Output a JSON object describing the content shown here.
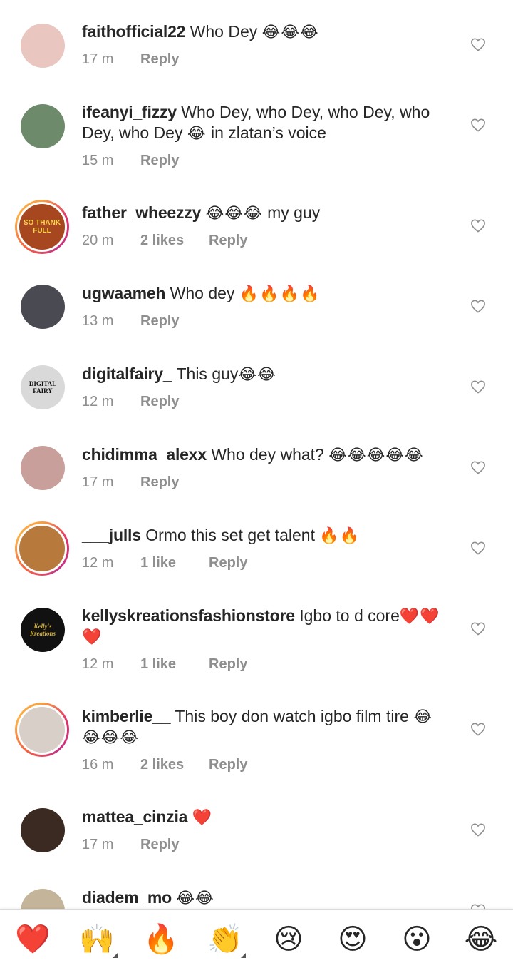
{
  "comments": [
    {
      "username": "faithofficial22",
      "text": "Who Dey ",
      "emoji": "😂😂😂",
      "text2": "",
      "emoji2": "",
      "time": "17 m",
      "likes": "",
      "reply": "Reply",
      "avatar_color": "#e9c7c0",
      "avatar_label": "",
      "story": false
    },
    {
      "username": "ifeanyi_fizzy",
      "text": "Who Dey, who Dey, who Dey, who Dey, who Dey ",
      "emoji": "😂",
      "text2": " in zlatan’s voice",
      "emoji2": "",
      "time": "15 m",
      "likes": "",
      "reply": "Reply",
      "avatar_color": "#6d8a6a",
      "avatar_label": "",
      "story": false
    },
    {
      "username": "father_wheezzy",
      "text": "",
      "emoji": "😂😂😂",
      "text2": " my guy",
      "emoji2": "",
      "time": "20 m",
      "likes": "2 likes",
      "reply": "Reply",
      "avatar_color": "#a6471f",
      "avatar_label": "SO THANK FULL",
      "story": true
    },
    {
      "username": "ugwaameh",
      "text": "Who dey ",
      "emoji": "🔥🔥🔥🔥",
      "text2": "",
      "emoji2": "",
      "time": "13 m",
      "likes": "",
      "reply": "Reply",
      "avatar_color": "#4a4a52",
      "avatar_label": "",
      "story": false
    },
    {
      "username": "digitalfairy_",
      "text": "This guy",
      "emoji": "😂😂",
      "text2": "",
      "emoji2": "",
      "time": "12 m",
      "likes": "",
      "reply": "Reply",
      "avatar_color": "#d9d9d9",
      "avatar_label": "DIGITAL FAIRY",
      "story": false
    },
    {
      "username": "chidimma_alexx",
      "text": "Who dey what? ",
      "emoji": "😂😂😂😂😂",
      "text2": "",
      "emoji2": "",
      "time": "17 m",
      "likes": "",
      "reply": "Reply",
      "avatar_color": "#c89f9a",
      "avatar_label": "",
      "story": false
    },
    {
      "username": "___julls",
      "text": "Ormo this set get talent ",
      "emoji": "🔥🔥",
      "text2": "",
      "emoji2": "",
      "time": "12 m",
      "likes": "1 like",
      "reply": "Reply",
      "avatar_color": "#b77a3c",
      "avatar_label": "",
      "story": true
    },
    {
      "username": "kellyskreationsfashionstore",
      "text": "Igbo to d core",
      "emoji": "❤️❤️❤️",
      "text2": "",
      "emoji2": "",
      "time": "12 m",
      "likes": "1 like",
      "reply": "Reply",
      "avatar_color": "#111111",
      "avatar_label": "Kelly's Kreations",
      "story": false
    },
    {
      "username": "kimberlie__",
      "text": "This boy don watch igbo film tire ",
      "emoji": "😂😂😂😂",
      "text2": "",
      "emoji2": "",
      "time": "16 m",
      "likes": "2 likes",
      "reply": "Reply",
      "avatar_color": "#d8cfc8",
      "avatar_label": "",
      "story": true
    },
    {
      "username": "mattea_cinzia",
      "text": "",
      "emoji": "❤️",
      "text2": "",
      "emoji2": "",
      "time": "17 m",
      "likes": "",
      "reply": "Reply",
      "avatar_color": "#3b2a22",
      "avatar_label": "",
      "story": false
    },
    {
      "username": "diadem_mo",
      "text": "",
      "emoji": "😂😂",
      "text2": "",
      "emoji2": "",
      "time": "",
      "likes": "",
      "reply": "",
      "avatar_color": "#c4b49a",
      "avatar_label": "",
      "story": false
    }
  ],
  "reactions": [
    {
      "name": "heart",
      "glyph": "❤️"
    },
    {
      "name": "raising-hands",
      "glyph": "🙌"
    },
    {
      "name": "fire",
      "glyph": "🔥"
    },
    {
      "name": "clapping-hands",
      "glyph": "👏"
    },
    {
      "name": "crying-face",
      "glyph": "😢"
    },
    {
      "name": "heart-eyes",
      "glyph": "😍"
    },
    {
      "name": "surprised-face",
      "glyph": "😮"
    },
    {
      "name": "tears-of-joy",
      "glyph": "😂"
    }
  ],
  "colors": {
    "text": "#262626",
    "meta": "#8e8e8e",
    "heart_outline": "#8e8e8e",
    "like_red": "#e0142b"
  }
}
